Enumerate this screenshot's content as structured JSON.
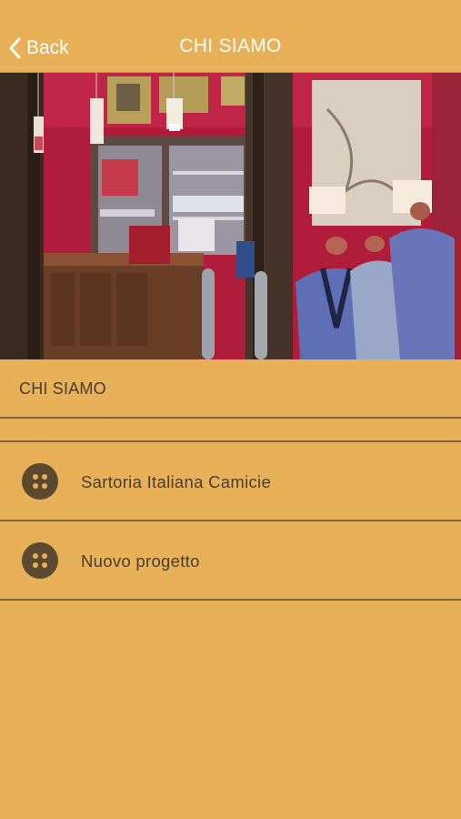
{
  "header": {
    "back_label": "Back",
    "title": "CHI SIAMO"
  },
  "section": {
    "title": "CHI SIAMO"
  },
  "items": [
    {
      "label": "Sartoria Italiana Camicie",
      "icon": "button-icon"
    },
    {
      "label": "Nuovo progetto",
      "icon": "button-icon"
    }
  ],
  "colors": {
    "background": "#e8b057",
    "text": "#4a3e2c",
    "icon": "#5b4a30",
    "divider": "#7a6540"
  }
}
